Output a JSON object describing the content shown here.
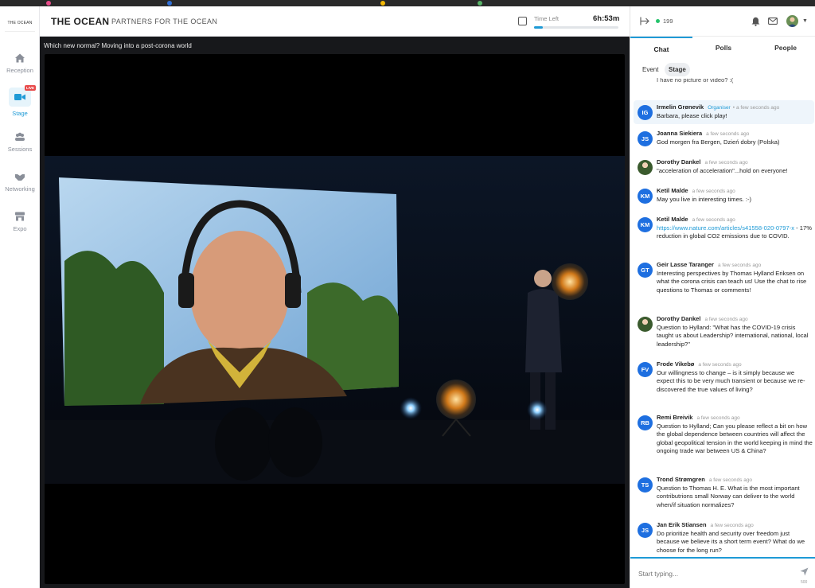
{
  "app": {
    "brand": "THE OCEAN",
    "subbrand": "PARTNERS FOR THE OCEAN",
    "logo_text": "THE OCEAN"
  },
  "timer": {
    "label": "Time Left",
    "value": "6h:53m",
    "progress": 0.1
  },
  "sidebar": {
    "items": [
      {
        "label": "Reception",
        "icon": "home-icon"
      },
      {
        "label": "Stage",
        "icon": "video-camera-icon",
        "badge": "LIVE"
      },
      {
        "label": "Sessions",
        "icon": "people-group-icon"
      },
      {
        "label": "Networking",
        "icon": "handshake-icon"
      },
      {
        "label": "Expo",
        "icon": "store-icon"
      }
    ]
  },
  "stage": {
    "title": "Which new normal? Moving into a post-corona world"
  },
  "panel": {
    "online_count": "199",
    "tabs": [
      "Chat",
      "Polls",
      "People"
    ],
    "subtabs": [
      "Event",
      "Stage"
    ],
    "partial_message": "I have no picture or video? :(",
    "messages": [
      {
        "initials": "IG",
        "name": "Irmelin Grønevik",
        "role": "Organiser",
        "time": "a few seconds ago",
        "text": "Barbara, please click play!"
      },
      {
        "initials": "JS",
        "name": "Joanna Siekiera",
        "time": "a few seconds ago",
        "text": "God morgen fra Bergen, Dzień dobry (Polska)"
      },
      {
        "initials": "",
        "name": "Dorothy Dankel",
        "time": "a few seconds ago",
        "text": "\"acceleration of acceleration\"...hold on everyone!"
      },
      {
        "initials": "KM",
        "name": "Ketil Malde",
        "time": "a few seconds ago",
        "text": "May you live in interesting times. :-)"
      },
      {
        "initials": "KM",
        "name": "Ketil Malde",
        "time": "a few seconds ago",
        "link": "https://www.nature.com/articles/s41558-020-0797-x",
        "text": " - 17% reduction in global CO2 emissions due to COVID."
      },
      {
        "initials": "GT",
        "name": "Geir Lasse Taranger",
        "time": "a few seconds ago",
        "text": "Interesting perspectives by Thomas Hylland Eriksen on what the corona crisis can teach us! Use the chat to rise questions to Thomas or comments!"
      },
      {
        "initials": "",
        "name": "Dorothy Dankel",
        "time": "a few seconds ago",
        "text": "Question to Hylland: \"What has the COVID-19 crisis taught us about Leadership? international, national, local leadership?\""
      },
      {
        "initials": "FV",
        "name": "Frode Vikebø",
        "time": "a few seconds ago",
        "text": "Our willingness to change – is it simply because we expect this to be very much transient or because we re-discovered the true values of living?"
      },
      {
        "initials": "RB",
        "name": "Remi Breivik",
        "time": "a few seconds ago",
        "text": "Question to Hylland; Can you please reflect a bit on how the global dependence between countries will affect the global geopolitical tension in the world keeping in mind the ongoing trade war between US & China?"
      },
      {
        "initials": "TS",
        "name": "Trond Strømgren",
        "time": "a few seconds ago",
        "text": "Question to Thomas H. E. What is the most important contributrions small Norway can deliver to the world when/if situation normalizes?"
      },
      {
        "initials": "JS",
        "name": "Jan Erik Stiansen",
        "time": "a few seconds ago",
        "text": "Do prioritize health and security over freedom just because we believe its a short term event? What do we choose for the long run?"
      }
    ],
    "composer": {
      "placeholder": "Start typing...",
      "char_count": "500"
    }
  },
  "colors": {
    "accent": "#1e9ad6",
    "avatar": "#1e6fe0",
    "live": "#e84b4b",
    "online": "#24c36b"
  }
}
